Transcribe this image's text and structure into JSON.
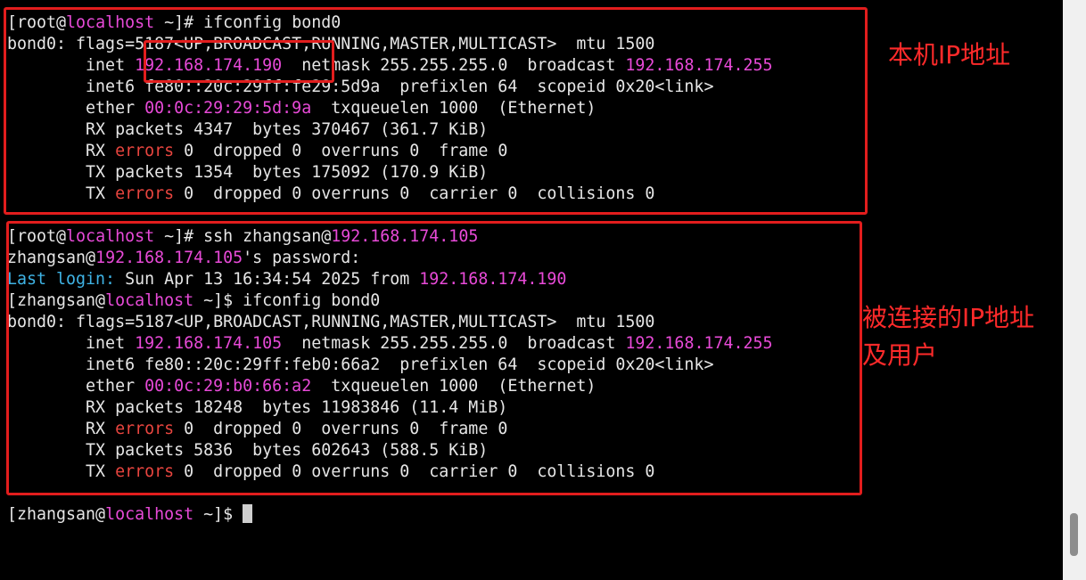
{
  "terminal": {
    "lines": [
      [
        {
          "t": "[root@",
          "c": "default"
        },
        {
          "t": "localhost",
          "c": "magenta"
        },
        {
          "t": " ~]# ifconfig bond0",
          "c": "default"
        }
      ],
      [
        {
          "t": "bond0: flags=5187<UP,BROADCAST,RUNNING,MASTER,MULTICAST>  mtu 1500",
          "c": "default"
        }
      ],
      [
        {
          "t": "        inet ",
          "c": "default"
        },
        {
          "t": "192.168.174.190",
          "c": "magenta"
        },
        {
          "t": "  netmask 255.255.255.0  broadcast ",
          "c": "default"
        },
        {
          "t": "192.168.174.255",
          "c": "magenta"
        }
      ],
      [
        {
          "t": "        inet6 fe80::20c:29ff:fe29:5d9a  prefixlen 64  scopeid 0x20<link>",
          "c": "default"
        }
      ],
      [
        {
          "t": "        ether ",
          "c": "default"
        },
        {
          "t": "00:0c:29:29:5d:9a",
          "c": "magenta"
        },
        {
          "t": "  txqueuelen 1000  (Ethernet)",
          "c": "default"
        }
      ],
      [
        {
          "t": "        RX packets 4347  bytes 370467 (361.7 KiB)",
          "c": "default"
        }
      ],
      [
        {
          "t": "        RX ",
          "c": "default"
        },
        {
          "t": "errors",
          "c": "red"
        },
        {
          "t": " 0  dropped 0  overruns 0  frame 0",
          "c": "default"
        }
      ],
      [
        {
          "t": "        TX packets 1354  bytes 175092 (170.9 KiB)",
          "c": "default"
        }
      ],
      [
        {
          "t": "        TX ",
          "c": "default"
        },
        {
          "t": "errors",
          "c": "red"
        },
        {
          "t": " 0  dropped 0 overruns 0  carrier 0  collisions 0",
          "c": "default"
        }
      ],
      [
        {
          "t": "",
          "c": "default"
        }
      ],
      [
        {
          "t": "[root@",
          "c": "default"
        },
        {
          "t": "localhost",
          "c": "magenta"
        },
        {
          "t": " ~]# ssh zhangsan@",
          "c": "default"
        },
        {
          "t": "192.168.174.105",
          "c": "magenta"
        }
      ],
      [
        {
          "t": "zhangsan@",
          "c": "default"
        },
        {
          "t": "192.168.174.105",
          "c": "magenta"
        },
        {
          "t": "'s password:",
          "c": "default"
        }
      ],
      [
        {
          "t": "Last login:",
          "c": "cyan"
        },
        {
          "t": " Sun Apr 13 16:34:54 2025 from ",
          "c": "default"
        },
        {
          "t": "192.168.174.190",
          "c": "magenta"
        }
      ],
      [
        {
          "t": "[zhangsan@",
          "c": "default"
        },
        {
          "t": "localhost",
          "c": "magenta"
        },
        {
          "t": " ~]$ ifconfig bond0",
          "c": "default"
        }
      ],
      [
        {
          "t": "bond0: flags=5187<UP,BROADCAST,RUNNING,MASTER,MULTICAST>  mtu 1500",
          "c": "default"
        }
      ],
      [
        {
          "t": "        inet ",
          "c": "default"
        },
        {
          "t": "192.168.174.105",
          "c": "magenta"
        },
        {
          "t": "  netmask 255.255.255.0  broadcast ",
          "c": "default"
        },
        {
          "t": "192.168.174.255",
          "c": "magenta"
        }
      ],
      [
        {
          "t": "        inet6 fe80::20c:29ff:feb0:66a2  prefixlen 64  scopeid 0x20<link>",
          "c": "default"
        }
      ],
      [
        {
          "t": "        ether ",
          "c": "default"
        },
        {
          "t": "00:0c:29:b0:66:a2",
          "c": "magenta"
        },
        {
          "t": "  txqueuelen 1000  (Ethernet)",
          "c": "default"
        }
      ],
      [
        {
          "t": "        RX packets 18248  bytes 11983846 (11.4 MiB)",
          "c": "default"
        }
      ],
      [
        {
          "t": "        RX ",
          "c": "default"
        },
        {
          "t": "errors",
          "c": "red"
        },
        {
          "t": " 0  dropped 0  overruns 0  frame 0",
          "c": "default"
        }
      ],
      [
        {
          "t": "        TX packets 5836  bytes 602643 (588.5 KiB)",
          "c": "default"
        }
      ],
      [
        {
          "t": "        TX ",
          "c": "default"
        },
        {
          "t": "errors",
          "c": "red"
        },
        {
          "t": " 0  dropped 0 overruns 0  carrier 0  collisions 0",
          "c": "default"
        }
      ],
      [
        {
          "t": "",
          "c": "default"
        }
      ],
      [
        {
          "t": "[zhangsan@",
          "c": "default"
        },
        {
          "t": "localhost",
          "c": "magenta"
        },
        {
          "t": " ~]$ ",
          "c": "default"
        },
        {
          "t": "",
          "c": "cursor"
        }
      ]
    ]
  },
  "annotations": {
    "top_label": "本机IP地址",
    "bottom_label_line1": "被连接的IP地址",
    "bottom_label_line2": "及用户"
  },
  "colors": {
    "background": "#000000",
    "text": "#e6e6e6",
    "magenta": "#e84ad8",
    "red": "#e8453f",
    "cyan": "#3fb4e6",
    "annotation": "#e21d1d"
  }
}
